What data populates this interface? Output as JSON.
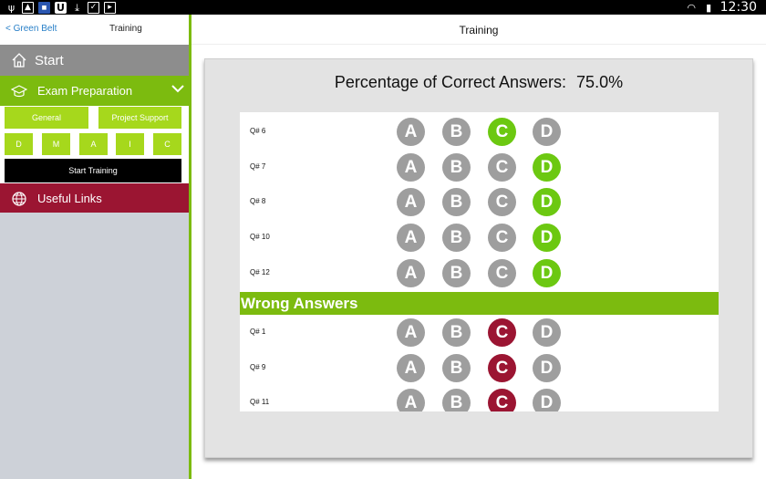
{
  "status_bar": {
    "time": "12:30"
  },
  "sidebar": {
    "back_label": "Green Belt",
    "title": "Training",
    "start_label": "Start",
    "exam_label": "Exam Preparation",
    "sub_buttons": {
      "general": "General",
      "project_support": "Project Support",
      "d": "D",
      "m": "M",
      "a": "A",
      "i": "I",
      "c": "C",
      "start_training": "Start Training"
    },
    "links_label": "Useful Links"
  },
  "main": {
    "title": "Training",
    "percentage_label": "Percentage of Correct Answers:",
    "percentage_value": "75.0%",
    "options": [
      "A",
      "B",
      "C",
      "D"
    ],
    "correct_rows": [
      {
        "label": "Q# 6",
        "answer": "C"
      },
      {
        "label": "Q# 7",
        "answer": "D"
      },
      {
        "label": "Q# 8",
        "answer": "D"
      },
      {
        "label": "Q# 10",
        "answer": "D"
      },
      {
        "label": "Q# 12",
        "answer": "D"
      }
    ],
    "wrong_header": "Wrong Answers",
    "wrong_rows": [
      {
        "label": "Q# 1",
        "answer": "C"
      },
      {
        "label": "Q# 9",
        "answer": "C"
      },
      {
        "label": "Q# 11",
        "answer": "C"
      }
    ]
  },
  "colors": {
    "accent_green": "#7cbb0f",
    "correct_green": "#6cc811",
    "wrong_red": "#9b1532",
    "neutral_gray": "#9e9e9e"
  }
}
